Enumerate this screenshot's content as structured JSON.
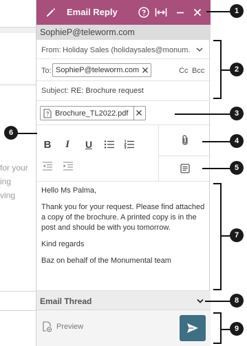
{
  "background": {
    "side_text": [
      "for your",
      "ing",
      "ving"
    ]
  },
  "titlebar": {
    "title": "Email Reply",
    "bg_color": "#a84f7c",
    "icons": [
      "pencil-icon",
      "help-icon",
      "expand-width-icon",
      "minimize-icon",
      "close-icon"
    ]
  },
  "recipient_banner": "SophieP@teleworm.com",
  "from": {
    "label": "From:",
    "value": "Holiday Sales (holidaysales@monum..."
  },
  "to": {
    "label": "To:",
    "chip": "SophieP@teleworm.com",
    "cc": "Cc",
    "bcc": "Bcc"
  },
  "subject": {
    "label": "Subject:",
    "value": "RE: Brochure request"
  },
  "attachment": {
    "filename": "Brochure_TL2022.pdf"
  },
  "format_toolbar": {
    "bold": "B",
    "italic": "I",
    "underline": "U"
  },
  "body": {
    "greeting": "Hello Ms Palma,",
    "paragraph": "Thank you for your request. Please find attached a copy of the brochure. A printed copy is in the post and should be with you tomorrow.",
    "closing": "Kind regards",
    "signature": "Baz on behalf of the Monumental team"
  },
  "thread": {
    "label": "Email Thread"
  },
  "footer": {
    "preview": "Preview",
    "send_color": "#3e6f84"
  },
  "callouts": {
    "c1": "1",
    "c2": "2",
    "c3": "3",
    "c4": "4",
    "c5": "5",
    "c6": "6",
    "c7": "7",
    "c8": "8",
    "c9": "9"
  }
}
